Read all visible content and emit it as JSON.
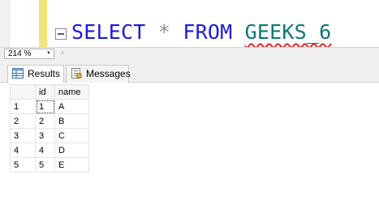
{
  "editor": {
    "sql": {
      "select_kw": "SELECT",
      "star": "*",
      "from_kw": "FROM",
      "table_name": "GEEKS_6"
    }
  },
  "zoom": {
    "value": "214 %",
    "dropdown_icon": "dropdown-arrow",
    "scroll_icon": "scroll-left-arrow"
  },
  "tabs": [
    {
      "label": "Results",
      "icon": "grid-icon",
      "active": true
    },
    {
      "label": "Messages",
      "icon": "messages-icon",
      "active": false
    }
  ],
  "grid": {
    "columns": [
      "",
      "id",
      "name"
    ],
    "rows": [
      {
        "row": "1",
        "id": "1",
        "name": "A"
      },
      {
        "row": "2",
        "id": "2",
        "name": "B"
      },
      {
        "row": "3",
        "id": "3",
        "name": "C"
      },
      {
        "row": "4",
        "id": "4",
        "name": "D"
      },
      {
        "row": "5",
        "id": "5",
        "name": "E"
      }
    ]
  },
  "colors": {
    "keyword": "#1b1bd8",
    "operator": "#8e8e8e",
    "table": "#0f7777",
    "squiggle": "#e02828",
    "change_bar": "#f0e47a"
  }
}
